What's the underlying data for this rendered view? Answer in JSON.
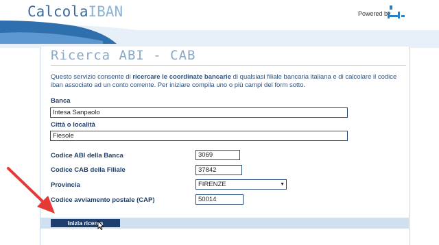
{
  "header": {
    "logo_part1": "Calcola",
    "logo_part2": "IBAN",
    "powered_by": "Powered by",
    "brand_icon": "brand-logo-icon"
  },
  "page": {
    "title": "Ricerca ABI - CAB",
    "intro_before": "Questo servizio consente di ",
    "intro_bold": "ricercare le coordinate bancarie",
    "intro_after": " di qualsiasi filiale bancaria italiana e di calcolare il codice iban associato ad un conto corrente. Per iniziare compila uno o più campi del form sotto."
  },
  "form": {
    "banca_label": "Banca",
    "banca_value": "Intesa Sanpaolo",
    "citta_label": "Città o località",
    "citta_value": "Fiesole",
    "abi_label": "Codice ABI della Banca",
    "abi_value": "3069",
    "cab_label": "Codice CAB della Filiale",
    "cab_value": "37842",
    "provincia_label": "Provincia",
    "provincia_value": "FIRENZE",
    "cap_label": "Codice avviamento postale (CAP)",
    "cap_value": "50014",
    "submit_label": "Inizia ricerca"
  },
  "colors": {
    "accent_dark": "#1e3f6e",
    "accent_light": "#cfe0f0",
    "annotation_red": "#e53935"
  },
  "icons": [
    "brand-logo-icon",
    "dropdown-arrow-icon",
    "mouse-cursor-icon",
    "red-annotation-arrow"
  ]
}
